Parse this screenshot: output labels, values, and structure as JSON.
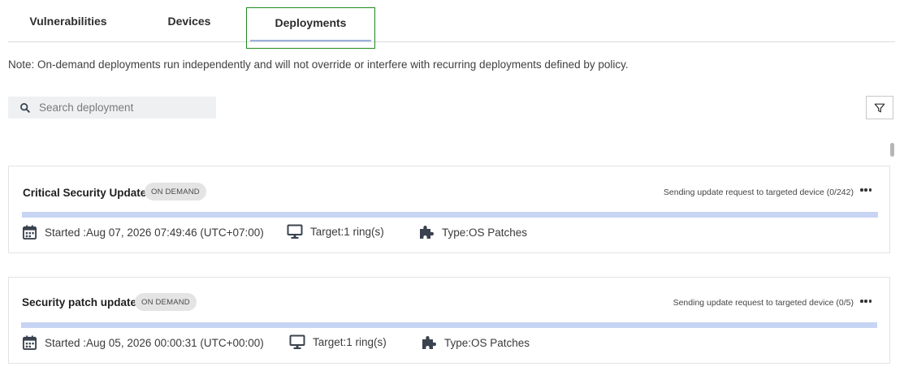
{
  "tabs": {
    "vulnerabilities": "Vulnerabilities",
    "devices": "Devices",
    "deployments": "Deployments"
  },
  "note": "Note: On-demand deployments run independently and will not override or interfere with recurring deployments defined by policy.",
  "search": {
    "placeholder": "Search deployment",
    "value": ""
  },
  "deployments": [
    {
      "title": "Critical Security Updates",
      "badge": "ON DEMAND",
      "status": "Sending update request to targeted device (0/242)",
      "started": "Started :Aug 07, 2026 07:49:46 (UTC+07:00)",
      "target": "Target:1 ring(s)",
      "type": "Type:OS Patches"
    },
    {
      "title": "Security patch update",
      "badge": "ON DEMAND",
      "status": "Sending update request to targeted device (0/5)",
      "started": "Started :Aug 05, 2026 00:00:31 (UTC+00:00)",
      "target": "Target:1 ring(s)",
      "type": "Type:OS Patches"
    }
  ],
  "colors": {
    "active_tab_border": "#1e8a1e",
    "tab_underline": "#9db1de",
    "progress_bar": "#c7d4f3",
    "icon": "#3b4350"
  },
  "icons": {
    "search": "search-icon",
    "filter": "filter-icon",
    "started": "calendar-icon",
    "target": "monitor-icon",
    "type": "puzzle-icon",
    "more": "more-horizontal-icon"
  }
}
